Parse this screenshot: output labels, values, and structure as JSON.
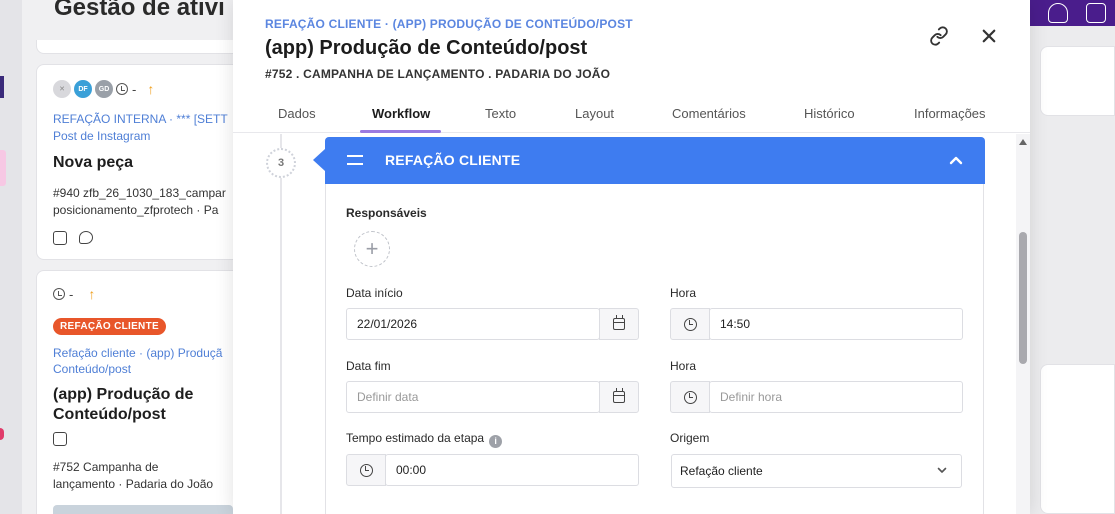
{
  "background": {
    "page_title": "Gestão de ativi",
    "card1": {
      "avatars": [
        "DF",
        "GD"
      ],
      "meta": "-",
      "crumb_line1": "REFAÇÃO INTERNA · *** [SETT",
      "crumb_line2": "Post de Instagram",
      "title": "Nova peça",
      "desc_line1": "#940 zfb_26_1030_183_campar",
      "desc_line2": "posicionamento_zfprotech  ·  Pa"
    },
    "card2": {
      "meta": "-",
      "tag": "REFAÇÃO CLIENTE",
      "crumb_line1": "Refação cliente · (app) Produçã",
      "crumb_line2": "Conteúdo/post",
      "title_line1": "(app) Produção de",
      "title_line2": "Conteúdo/post",
      "desc_line1": "#752 Campanha de",
      "desc_line2": "lançamento  ·  Padaria do João"
    }
  },
  "modal": {
    "breadcrumb": "REFAÇÃO CLIENTE · (APP) PRODUÇÃO DE CONTEÚDO/POST",
    "title": "(app) Produção de Conteúdo/post",
    "subtitle": "#752 . CAMPANHA DE LANÇAMENTO . PADARIA DO JOÃO",
    "tabs": [
      "Dados",
      "Workflow",
      "Texto",
      "Layout",
      "Comentários",
      "Histórico",
      "Informações"
    ],
    "active_tab": "Workflow",
    "step_number": "3",
    "stage": {
      "title": "REFAÇÃO CLIENTE",
      "responsaveis_label": "Responsáveis",
      "data_inicio_label": "Data início",
      "data_inicio_value": "22/01/2026",
      "hora_inicio_label": "Hora",
      "hora_inicio_value": "14:50",
      "data_fim_label": "Data fim",
      "data_fim_placeholder": "Definir data",
      "hora_fim_label": "Hora",
      "hora_fim_placeholder": "Definir hora",
      "tempo_label": "Tempo estimado da etapa",
      "tempo_value": "00:00",
      "origem_label": "Origem",
      "origem_value": "Refação cliente"
    }
  },
  "colors": {
    "accent_blue": "#3e7cf0",
    "tab_underline": "#9b7be0",
    "tag_orange": "#e8562a",
    "link_blue": "#5b86e0"
  }
}
